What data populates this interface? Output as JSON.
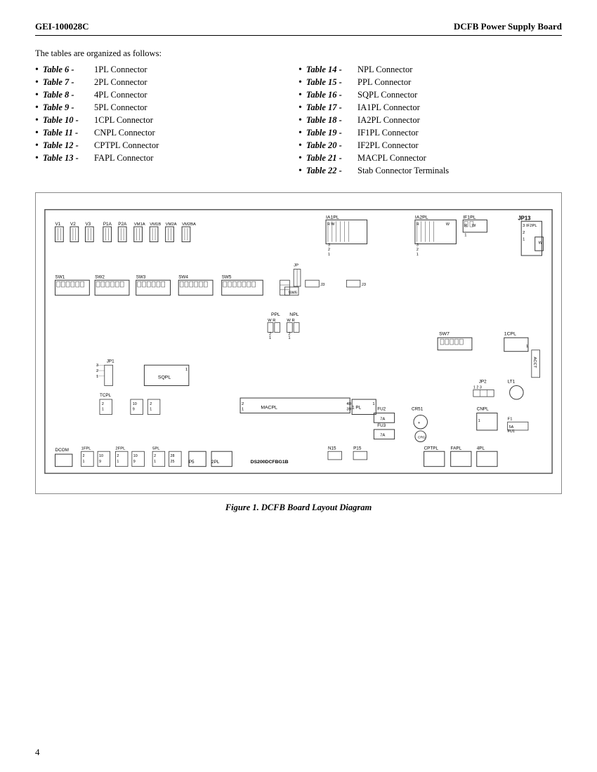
{
  "header": {
    "left": "GEI-100028C",
    "right": "DCFB Power Supply Board"
  },
  "intro": "The tables are organized as follows:",
  "tables_left": [
    {
      "num": "Table 6 -",
      "desc": "1PL Connector"
    },
    {
      "num": "Table 7 -",
      "desc": "2PL Connector"
    },
    {
      "num": "Table 8 -",
      "desc": "4PL Connector"
    },
    {
      "num": "Table 9 -",
      "desc": "5PL Connector"
    },
    {
      "num": "Table 10 -",
      "desc": "1CPL Connector"
    },
    {
      "num": "Table 11 -",
      "desc": "CNPL Connector"
    },
    {
      "num": "Table 12 -",
      "desc": "CPTPL Connector"
    },
    {
      "num": "Table 13 -",
      "desc": "FAPL Connector"
    }
  ],
  "tables_right": [
    {
      "num": "Table 14 -",
      "desc": "NPL Connector"
    },
    {
      "num": "Table 15 -",
      "desc": "PPL Connector"
    },
    {
      "num": "Table 16 -",
      "desc": "SQPL Connector"
    },
    {
      "num": "Table 17 -",
      "desc": "IA1PL Connector"
    },
    {
      "num": "Table 18 -",
      "desc": "IA2PL Connector"
    },
    {
      "num": "Table 19 -",
      "desc": "IF1PL Connector"
    },
    {
      "num": "Table 20 -",
      "desc": "IF2PL Connector"
    },
    {
      "num": "Table 21 -",
      "desc": "MACPL Connector"
    },
    {
      "num": "Table 22 -",
      "desc": "Stab Connector Terminals"
    }
  ],
  "figure_caption": "Figure 1.  DCFB Board Layout Diagram",
  "page_number": "4"
}
